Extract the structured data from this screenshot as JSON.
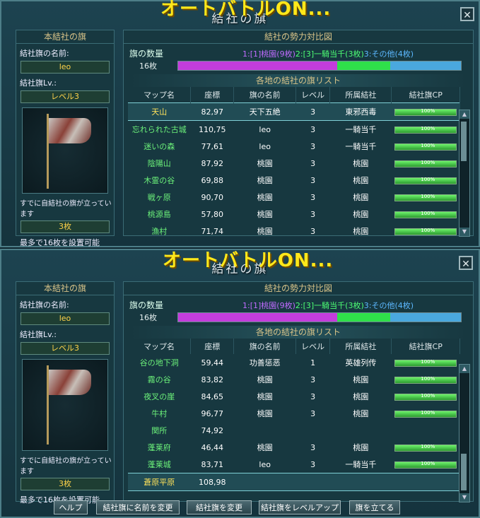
{
  "top": {
    "overlay": "オートバトルON...",
    "title": "結社の旗",
    "left_title": "本結社の旗",
    "name_label": "結社旗の名前:",
    "name_value": "leo",
    "level_label": "結社旗Lv.:",
    "level_value": "レベル3",
    "already_label": "すでに自結社の旗が立っています",
    "already_value": "3枚",
    "max_note": "最多で16枚を設置可能",
    "right_title": "結社の勢力対比図",
    "count_label": "旗の数量",
    "count_text_1": "1:[1]桃園(9枚)",
    "count_text_2": "2:[3]一騎当千(3枚)",
    "count_text_3": "3:その他(4枚)",
    "bar_label": "16枚",
    "bar": [
      {
        "value": 9,
        "color": "#c33ddc"
      },
      {
        "value": 3,
        "color": "#2fe04a"
      },
      {
        "value": 4,
        "color": "#4aa8de"
      }
    ],
    "list_title": "各地の結社の旗リスト",
    "headers": [
      "マップ名",
      "座標",
      "旗の名前",
      "レベル",
      "所属結社",
      "結社旗CP"
    ],
    "rows": [
      {
        "map": "天山",
        "coord": "82,97",
        "flag": "天下五絶",
        "level": "3",
        "guild": "東邪西毒",
        "cp": "100%",
        "selected": true
      },
      {
        "map": "忘れられた古城",
        "coord": "110,75",
        "flag": "leo",
        "level": "3",
        "guild": "一騎当千",
        "cp": "100%"
      },
      {
        "map": "迷いの森",
        "coord": "77,61",
        "flag": "leo",
        "level": "3",
        "guild": "一騎当千",
        "cp": "100%"
      },
      {
        "map": "陰陽山",
        "coord": "87,92",
        "flag": "桃園",
        "level": "3",
        "guild": "桃園",
        "cp": "100%"
      },
      {
        "map": "木霊の谷",
        "coord": "69,88",
        "flag": "桃園",
        "level": "3",
        "guild": "桃園",
        "cp": "100%"
      },
      {
        "map": "戦ヶ原",
        "coord": "90,70",
        "flag": "桃園",
        "level": "3",
        "guild": "桃園",
        "cp": "100%"
      },
      {
        "map": "桃源島",
        "coord": "57,80",
        "flag": "桃園",
        "level": "3",
        "guild": "桃園",
        "cp": "100%"
      },
      {
        "map": "漁村",
        "coord": "71,74",
        "flag": "桃園",
        "level": "3",
        "guild": "桃園",
        "cp": "100%"
      }
    ]
  },
  "bottom": {
    "overlay": "オートバトルON...",
    "title": "結社の旗",
    "left_title": "本結社の旗",
    "name_label": "結社旗の名前:",
    "name_value": "leo",
    "level_label": "結社旗Lv.:",
    "level_value": "レベル3",
    "already_label": "すでに自結社の旗が立っています",
    "already_value": "3枚",
    "max_note": "最多で16枚を設置可能",
    "right_title": "結社の勢力対比図",
    "count_label": "旗の数量",
    "count_text_1": "1:[1]桃園(9枚)",
    "count_text_2": "2:[3]一騎当千(3枚)",
    "count_text_3": "3:その他(4枚)",
    "bar_label": "16枚",
    "bar": [
      {
        "value": 9,
        "color": "#c33ddc"
      },
      {
        "value": 3,
        "color": "#2fe04a"
      },
      {
        "value": 4,
        "color": "#4aa8de"
      }
    ],
    "list_title": "各地の結社の旗リスト",
    "headers": [
      "マップ名",
      "座標",
      "旗の名前",
      "レベル",
      "所属結社",
      "結社旗CP"
    ],
    "rows": [
      {
        "map": "谷の地下洞",
        "coord": "59,44",
        "flag": "功善惩恶",
        "level": "1",
        "guild": "英雄列传",
        "cp": "100%"
      },
      {
        "map": "霧の谷",
        "coord": "83,82",
        "flag": "桃園",
        "level": "3",
        "guild": "桃園",
        "cp": "100%"
      },
      {
        "map": "夜叉の崖",
        "coord": "84,65",
        "flag": "桃園",
        "level": "3",
        "guild": "桃園",
        "cp": "100%"
      },
      {
        "map": "牛村",
        "coord": "96,77",
        "flag": "桃園",
        "level": "3",
        "guild": "桃園",
        "cp": "100%"
      },
      {
        "map": "関所",
        "coord": "74,92",
        "flag": "",
        "level": "",
        "guild": "",
        "cp": ""
      },
      {
        "map": "蓬莱府",
        "coord": "46,44",
        "flag": "桃園",
        "level": "3",
        "guild": "桃園",
        "cp": "100%"
      },
      {
        "map": "蓬莱城",
        "coord": "83,71",
        "flag": "leo",
        "level": "3",
        "guild": "一騎当千",
        "cp": "100%"
      },
      {
        "map": "蒼原平原",
        "coord": "108,98",
        "flag": "",
        "level": "",
        "guild": "",
        "cp": "",
        "selected": true
      }
    ],
    "buttons": [
      "ヘルプ",
      "結社旗に名前を変更",
      "結社旗を変更",
      "結社旗をレベルアップ",
      "旗を立てる"
    ]
  }
}
